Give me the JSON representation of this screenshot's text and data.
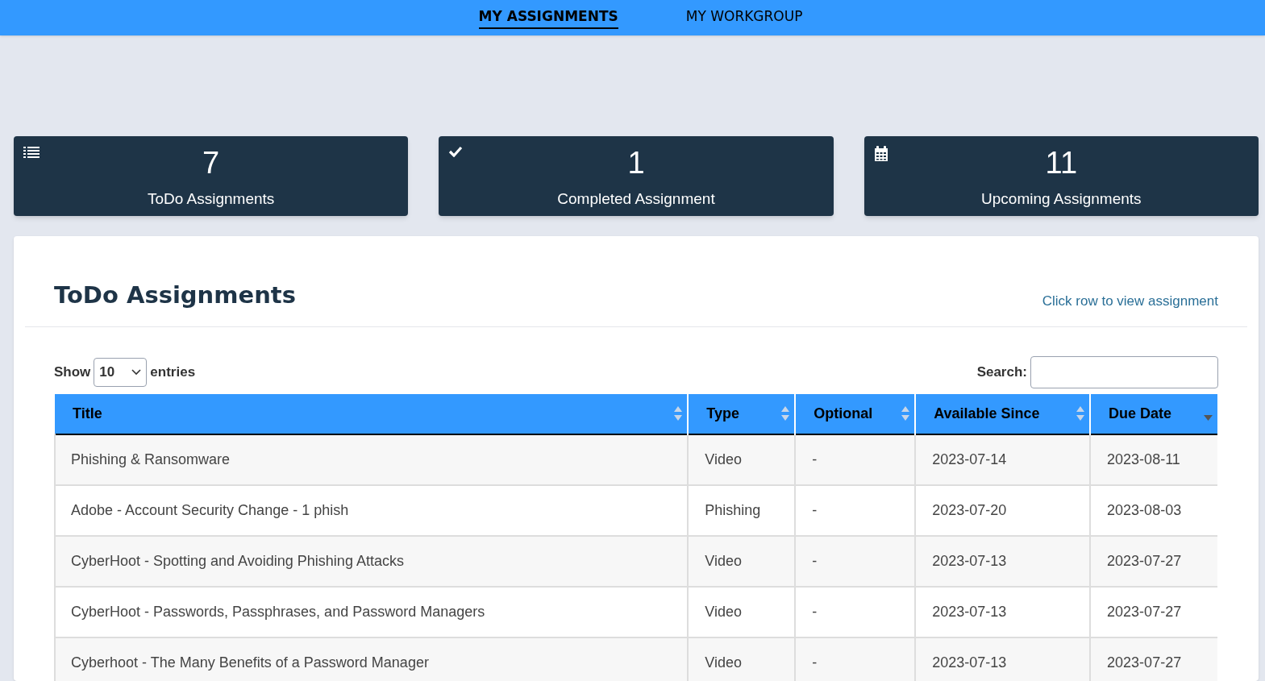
{
  "nav": {
    "tabs": [
      {
        "label": "MY ASSIGNMENTS",
        "selected": true
      },
      {
        "label": "MY WORKGROUP",
        "selected": false
      }
    ]
  },
  "stats": [
    {
      "kind": "list",
      "count": "7",
      "label": "ToDo Assignments"
    },
    {
      "kind": "check",
      "count": "1",
      "label": "Completed Assignment"
    },
    {
      "kind": "calendar",
      "count": "11",
      "label": "Upcoming Assignments"
    }
  ],
  "panel": {
    "title": "ToDo Assignments",
    "hint": "Click row to view assignment",
    "length": {
      "before": "Show",
      "value": "10",
      "after": "entries"
    },
    "search": {
      "label": "Search:"
    },
    "table": {
      "columns": [
        {
          "label": "Title",
          "sorted": false
        },
        {
          "label": "Type",
          "sorted": false
        },
        {
          "label": "Optional",
          "sorted": false
        },
        {
          "label": "Available Since",
          "sorted": false
        },
        {
          "label": "Due Date",
          "sorted": true
        }
      ],
      "rows": [
        [
          "Phishing & Ransomware",
          "Video",
          "-",
          "2023-07-14",
          "2023-08-11"
        ],
        [
          "Adobe - Account Security Change - 1 phish",
          "Phishing",
          "-",
          "2023-07-20",
          "2023-08-03"
        ],
        [
          "CyberHoot - Spotting and Avoiding Phishing Attacks",
          "Video",
          "-",
          "2023-07-13",
          "2023-07-27"
        ],
        [
          "CyberHoot - Passwords, Passphrases, and Password Managers",
          "Video",
          "-",
          "2023-07-13",
          "2023-07-27"
        ],
        [
          "Cyberhoot - The Many Benefits of a Password Manager",
          "Video",
          "-",
          "2023-07-13",
          "2023-07-27"
        ]
      ]
    }
  }
}
